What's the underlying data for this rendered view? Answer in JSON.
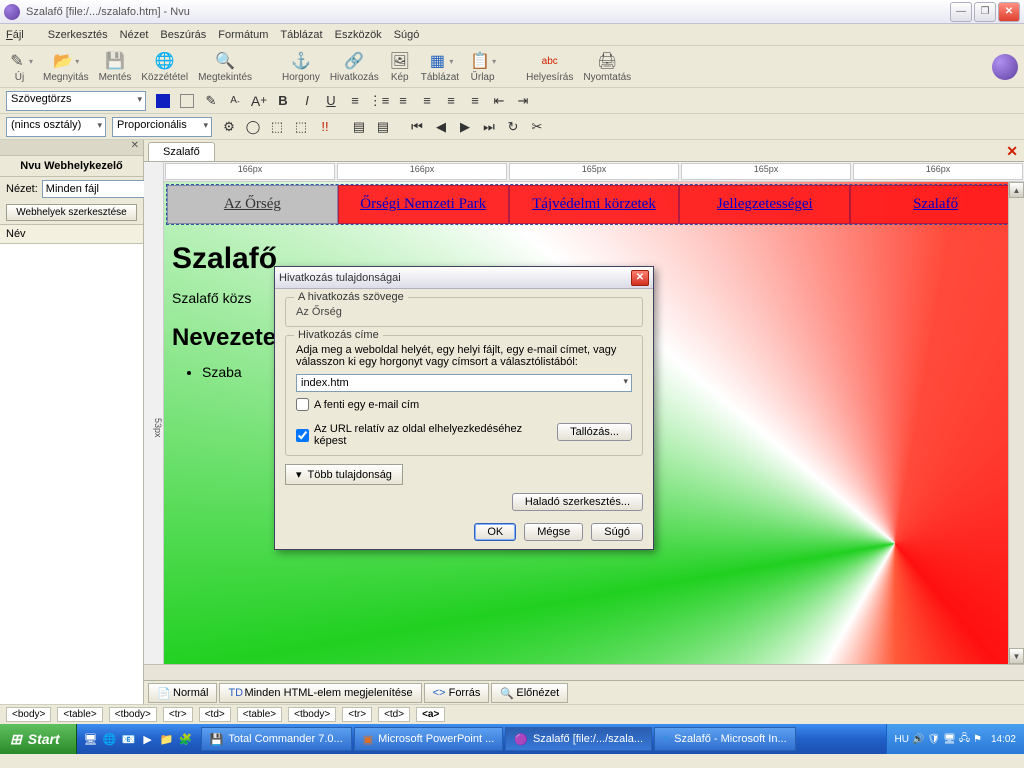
{
  "window": {
    "title": "Szalafő [file:/.../szalafo.htm]  - Nvu"
  },
  "menubar": [
    "Fájl",
    "Szerkesztés",
    "Nézet",
    "Beszúrás",
    "Formátum",
    "Táblázat",
    "Eszközök",
    "Súgó"
  ],
  "toolbar": {
    "new": "Új",
    "open": "Megnyitás",
    "save": "Mentés",
    "publish": "Közzététel",
    "browse": "Megtekintés",
    "anchor": "Horgony",
    "link": "Hivatkozás",
    "image": "Kép",
    "table": "Táblázat",
    "form": "Űrlap",
    "spell": "Helyesírás",
    "print": "Nyomtatás"
  },
  "fmt": {
    "para_combo": "Szövegtörzs",
    "class_combo": "(nincs osztály)",
    "font_combo": "Proporcionális"
  },
  "sidebar": {
    "title": "Nvu Webhelykezelő",
    "view_label": "Nézet:",
    "view_value": "Minden fájl",
    "edit_btn": "Webhelyek szerkesztése",
    "col_name": "Név"
  },
  "document": {
    "tab": "Szalafő",
    "vruler": "53px",
    "hruler": [
      "166px",
      "166px",
      "165px",
      "165px",
      "166px"
    ],
    "nav": [
      "Az Őrség",
      "Őrségi Nemzeti Park",
      "Tájvédelmi körzetek",
      "Jellegzetességei",
      "Szalafő"
    ],
    "h1": "Szalafő",
    "p1": "Szalafő közs",
    "h2": "Nevezete",
    "li1": "Szaba"
  },
  "viewtabs": {
    "normal": "Normál",
    "tags": "Minden HTML-elem megjelenítése",
    "source": "Forrás",
    "preview": "Előnézet"
  },
  "breadcrumb": [
    "<body>",
    "<table>",
    "<tbody>",
    "<tr>",
    "<td>",
    "<table>",
    "<tbody>",
    "<tr>",
    "<td>",
    "<a>"
  ],
  "dialog": {
    "title": "Hivatkozás tulajdonságai",
    "grp1": "A hivatkozás szövege",
    "linktext": "Az Őrség",
    "grp2": "Hivatkozás címe",
    "desc": "Adja meg a weboldal helyét, egy helyi fájlt, egy e-mail címet, vagy válasszon ki egy horgonyt vagy címsort a választólistából:",
    "url": "index.htm",
    "chk_email": "A fenti egy e-mail cím",
    "chk_rel": "Az URL relatív az oldal elhelyezkedéséhez képest",
    "browse": "Tallózás...",
    "more": "Több tulajdonság",
    "advanced": "Haladó szerkesztés...",
    "ok": "OK",
    "cancel": "Mégse",
    "help": "Súgó"
  },
  "taskbar": {
    "start": "Start",
    "items": [
      "Total Commander 7.0...",
      "Microsoft PowerPoint ...",
      "Szalafő [file:/.../szala...",
      "Szalafő - Microsoft In..."
    ],
    "lang": "HU",
    "clock": "14:02"
  }
}
